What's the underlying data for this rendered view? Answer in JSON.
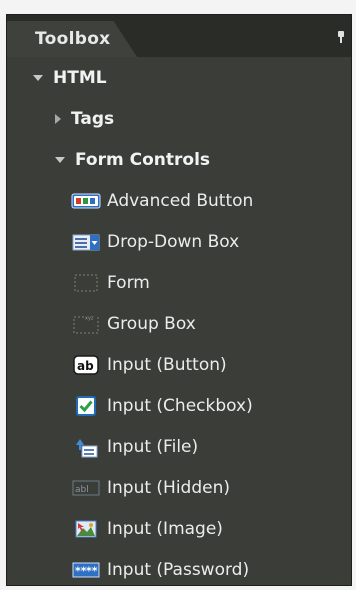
{
  "panel": {
    "title": "Toolbox"
  },
  "tree": {
    "root_label": "HTML",
    "tags_label": "Tags",
    "form_controls_label": "Form Controls",
    "items": [
      {
        "label": "Advanced Button",
        "icon": "advanced-button-icon"
      },
      {
        "label": "Drop-Down Box",
        "icon": "dropdown-box-icon"
      },
      {
        "label": "Form",
        "icon": "form-icon"
      },
      {
        "label": "Group Box",
        "icon": "group-box-icon"
      },
      {
        "label": "Input (Button)",
        "icon": "input-button-icon"
      },
      {
        "label": "Input (Checkbox)",
        "icon": "input-checkbox-icon"
      },
      {
        "label": "Input (File)",
        "icon": "input-file-icon"
      },
      {
        "label": "Input (Hidden)",
        "icon": "input-hidden-icon"
      },
      {
        "label": "Input (Image)",
        "icon": "input-image-icon"
      },
      {
        "label": "Input (Password)",
        "icon": "input-password-icon"
      }
    ]
  },
  "colors": {
    "panel_background": "#3a3d38",
    "header_background": "#2a2c28",
    "text": "#f2f2f2"
  }
}
